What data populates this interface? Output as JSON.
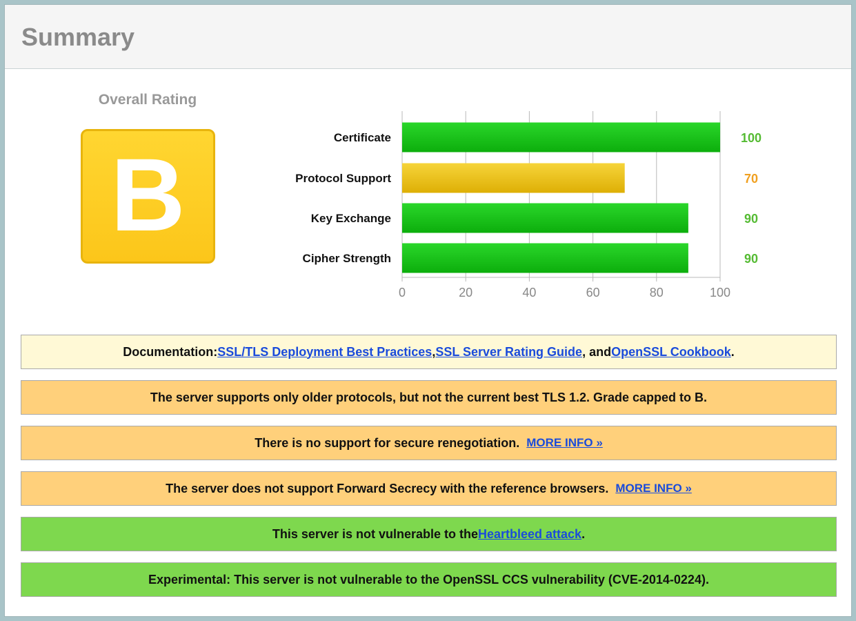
{
  "header": {
    "title": "Summary"
  },
  "rating": {
    "title": "Overall Rating",
    "grade": "B"
  },
  "chart_data": {
    "type": "bar",
    "orientation": "horizontal",
    "categories": [
      "Certificate",
      "Protocol Support",
      "Key Exchange",
      "Cipher Strength"
    ],
    "values": [
      100,
      70,
      90,
      90
    ],
    "value_colors": [
      "#55bb33",
      "#f0a020",
      "#55bb33",
      "#55bb33"
    ],
    "bar_colors": [
      "green",
      "yellow",
      "green",
      "green"
    ],
    "xlim": [
      0,
      100
    ],
    "xticks": [
      0,
      20,
      40,
      60,
      80,
      100
    ],
    "grid": true
  },
  "notices": {
    "documentation": {
      "prefix": "Documentation: ",
      "link1": "SSL/TLS Deployment Best Practices",
      "sep1": ", ",
      "link2": "SSL Server Rating Guide",
      "sep2": ", and ",
      "link3": "OpenSSL Cookbook",
      "suffix": "."
    },
    "protocols": {
      "text": "The server supports only older protocols, but not the current best TLS 1.2. Grade capped to B."
    },
    "renegotiation": {
      "text": "There is no support for secure renegotiation.",
      "more": "MORE INFO »"
    },
    "forward_secrecy": {
      "text": "The server does not support Forward Secrecy with the reference browsers.",
      "more": "MORE INFO »"
    },
    "heartbleed": {
      "prefix": "This server is not vulnerable to the ",
      "link": "Heartbleed attack",
      "suffix": "."
    },
    "ccs": {
      "text": "Experimental: This server is not vulnerable to the OpenSSL CCS vulnerability (CVE-2014-0224)."
    }
  },
  "colors": {
    "green_bar": "#22c722",
    "yellow_bar": "#f0c21a",
    "notice_yellow": "#fff9d6",
    "notice_orange": "#ffd07b",
    "notice_green": "#7ed84e",
    "link": "#1a4bdb"
  }
}
